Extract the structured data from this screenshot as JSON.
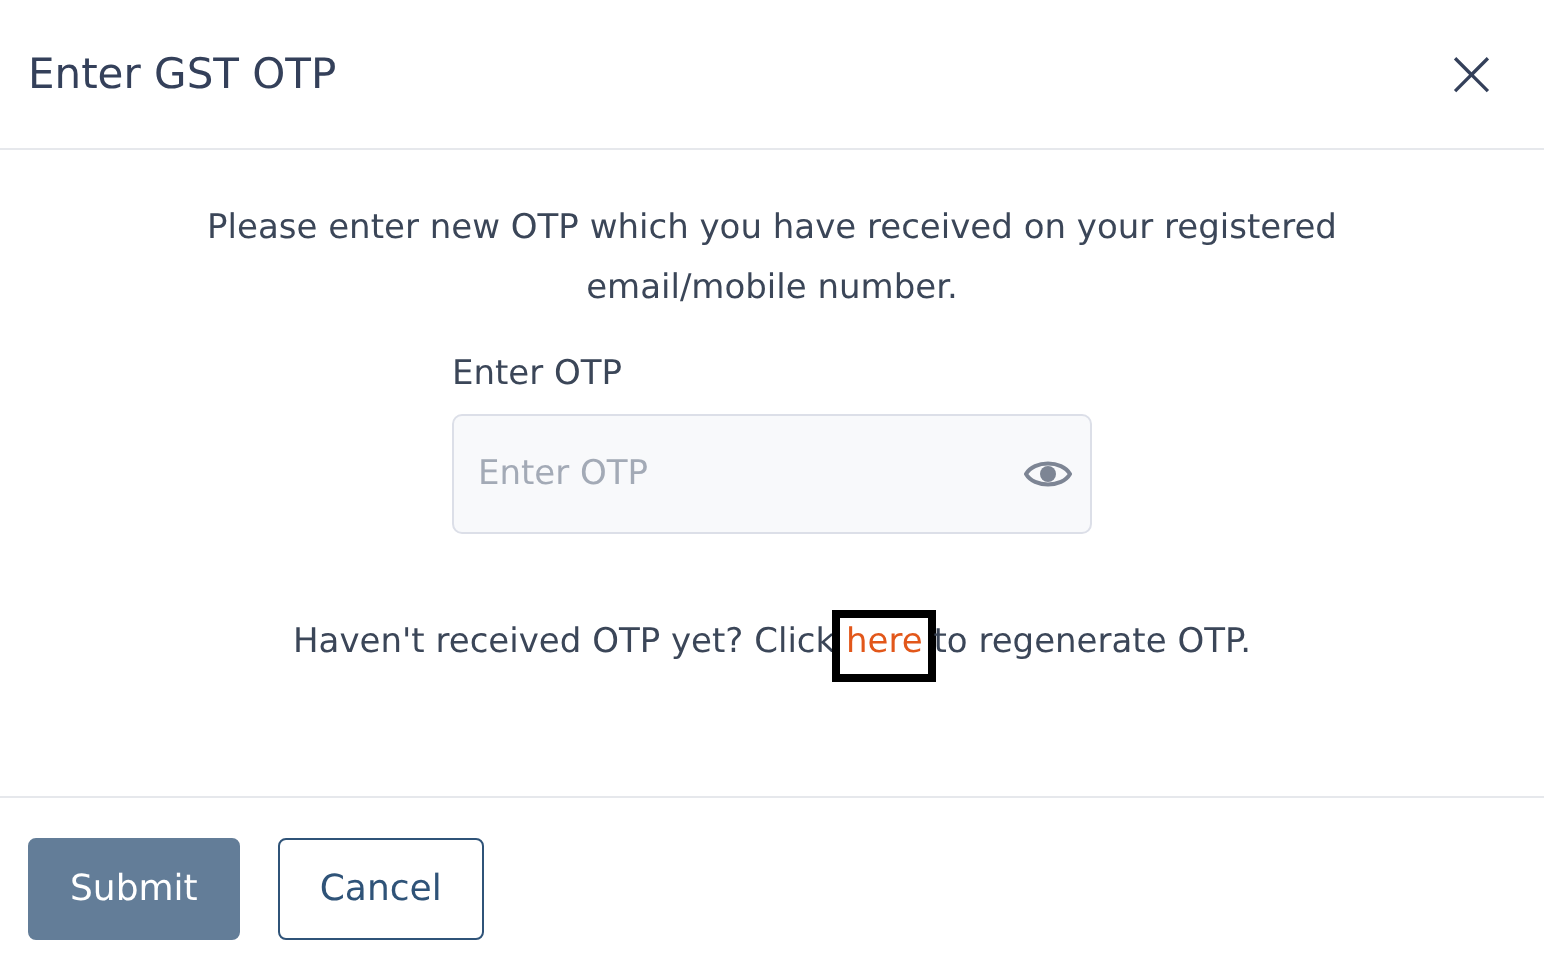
{
  "dialog": {
    "title": "Enter GST OTP",
    "close_icon": "×"
  },
  "message": "Please enter new OTP which you have received on your registered email/mobile number.",
  "otp_field": {
    "label": "Enter OTP",
    "placeholder": "Enter OTP",
    "password_hidden": true
  },
  "regenerate": {
    "before": "Haven't received OTP yet? Click ",
    "link": "here",
    "after": " to regenerate OTP.",
    "link_highlighted": true
  },
  "buttons": [
    {
      "label": "Submit",
      "kind": "primary",
      "disabled": true
    },
    {
      "label": "Cancel",
      "kind": "secondary",
      "disabled": false
    }
  ]
}
